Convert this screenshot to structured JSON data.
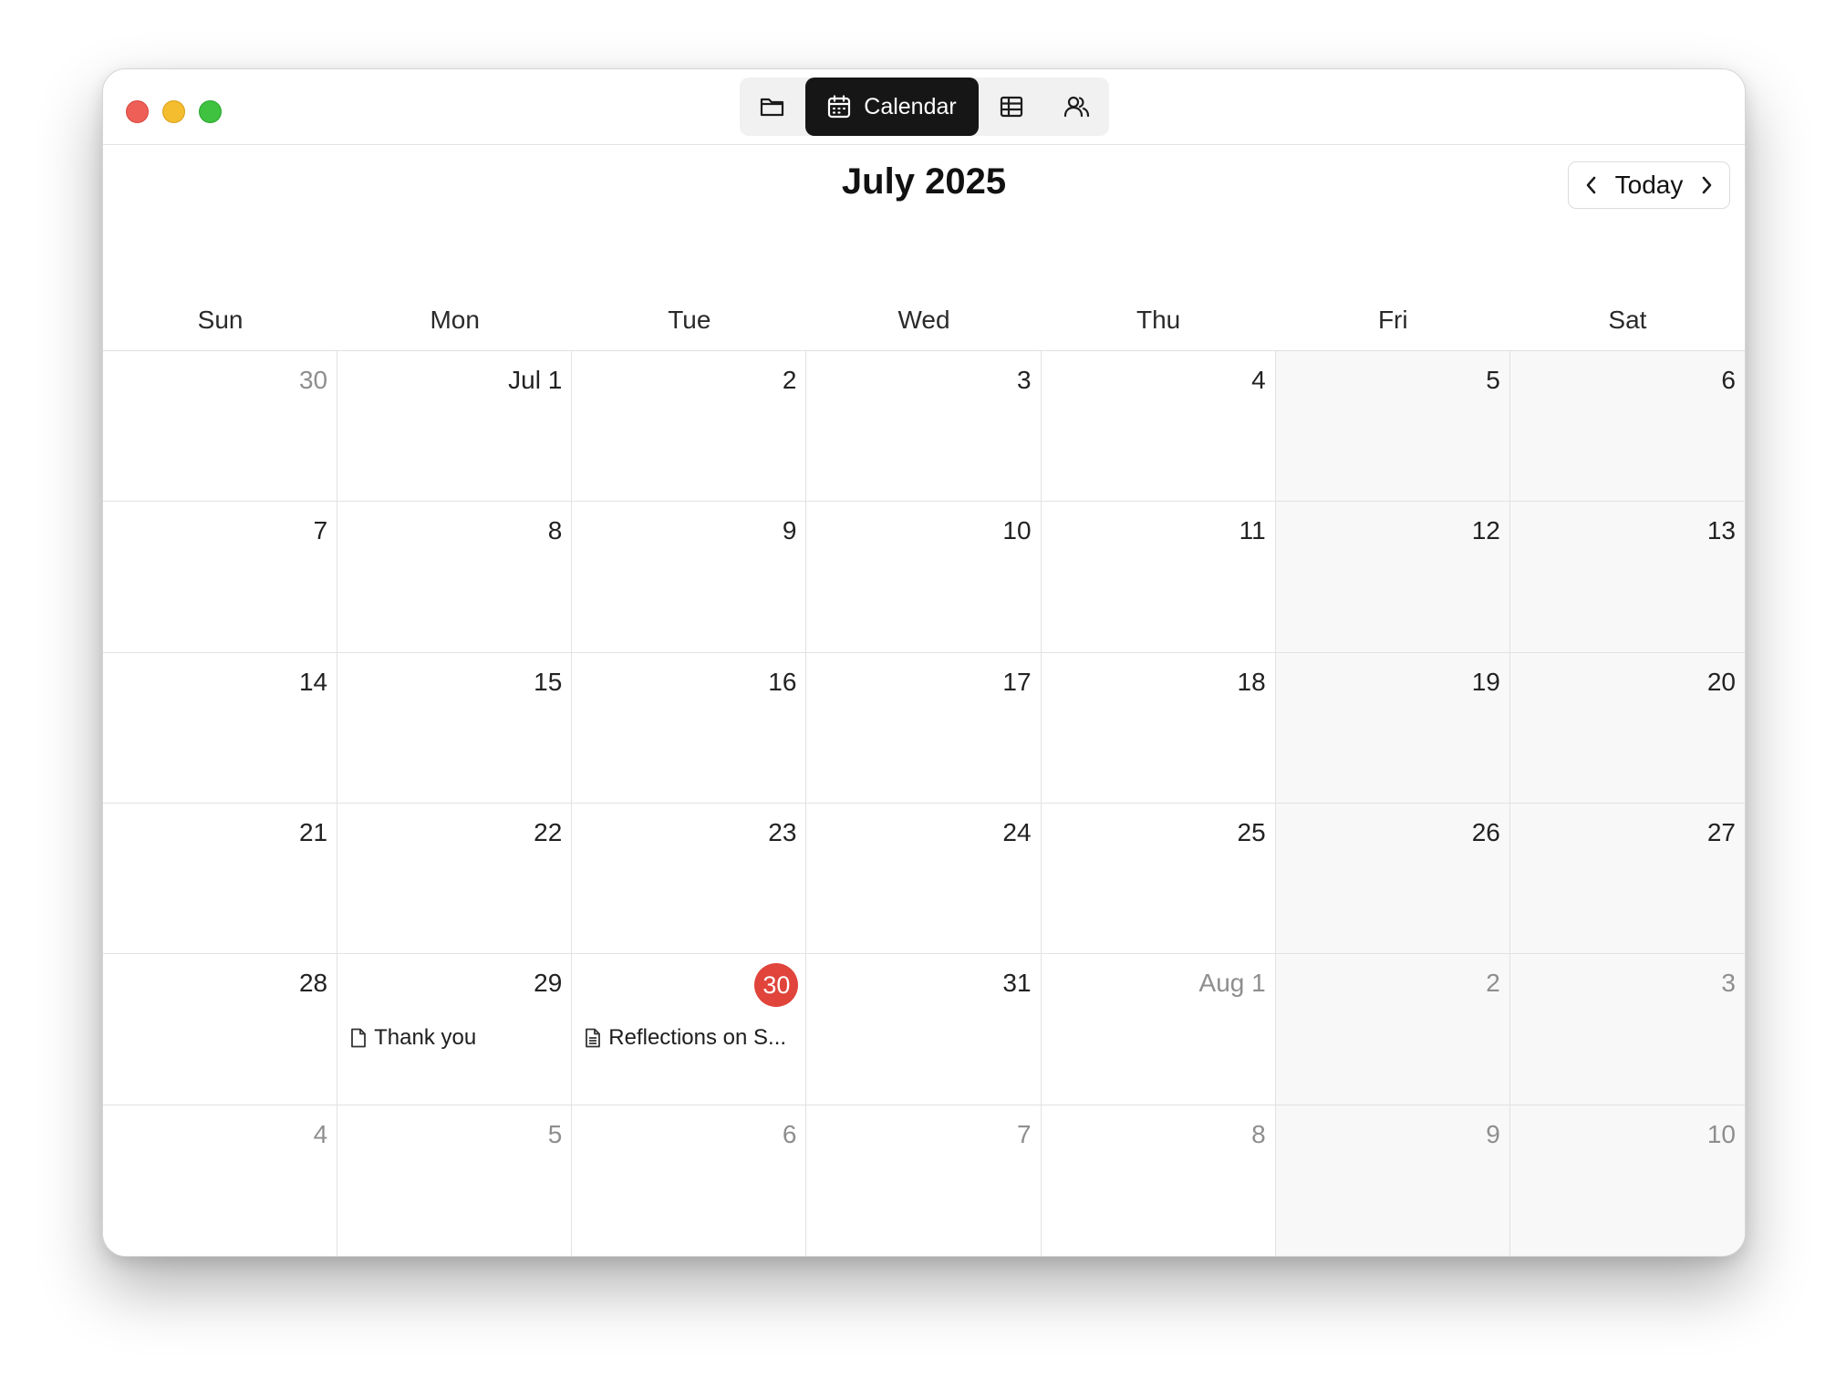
{
  "window": {
    "toolbar": {
      "views": [
        {
          "id": "folder",
          "icon": "folder-icon"
        },
        {
          "id": "calendar",
          "icon": "calendar-icon",
          "label": "Calendar",
          "active": true
        },
        {
          "id": "table",
          "icon": "table-icon"
        },
        {
          "id": "people",
          "icon": "people-icon"
        }
      ]
    }
  },
  "calendar": {
    "title": "July 2025",
    "today_label": "Today",
    "weekdays": [
      "Sun",
      "Mon",
      "Tue",
      "Wed",
      "Thu",
      "Fri",
      "Sat"
    ],
    "today_color": "#e0443b",
    "weeks": [
      [
        {
          "label": "30",
          "muted": true
        },
        {
          "label": "Jul 1"
        },
        {
          "label": "2"
        },
        {
          "label": "3"
        },
        {
          "label": "4"
        },
        {
          "label": "5"
        },
        {
          "label": "6"
        }
      ],
      [
        {
          "label": "7"
        },
        {
          "label": "8"
        },
        {
          "label": "9"
        },
        {
          "label": "10"
        },
        {
          "label": "11"
        },
        {
          "label": "12"
        },
        {
          "label": "13"
        }
      ],
      [
        {
          "label": "14"
        },
        {
          "label": "15"
        },
        {
          "label": "16"
        },
        {
          "label": "17"
        },
        {
          "label": "18"
        },
        {
          "label": "19"
        },
        {
          "label": "20"
        }
      ],
      [
        {
          "label": "21"
        },
        {
          "label": "22"
        },
        {
          "label": "23"
        },
        {
          "label": "24"
        },
        {
          "label": "25"
        },
        {
          "label": "26"
        },
        {
          "label": "27"
        }
      ],
      [
        {
          "label": "28"
        },
        {
          "label": "29",
          "events": [
            {
              "title": "Thank you",
              "icon": "document-icon"
            }
          ]
        },
        {
          "label": "30",
          "today": true,
          "events": [
            {
              "title": "Reflections on S...",
              "icon": "document-text-icon"
            }
          ]
        },
        {
          "label": "31"
        },
        {
          "label": "Aug 1",
          "muted": true
        },
        {
          "label": "2",
          "muted": true
        },
        {
          "label": "3",
          "muted": true
        }
      ],
      [
        {
          "label": "4",
          "muted": true
        },
        {
          "label": "5",
          "muted": true
        },
        {
          "label": "6",
          "muted": true
        },
        {
          "label": "7",
          "muted": true
        },
        {
          "label": "8",
          "muted": true
        },
        {
          "label": "9",
          "muted": true
        },
        {
          "label": "10",
          "muted": true
        }
      ]
    ]
  }
}
